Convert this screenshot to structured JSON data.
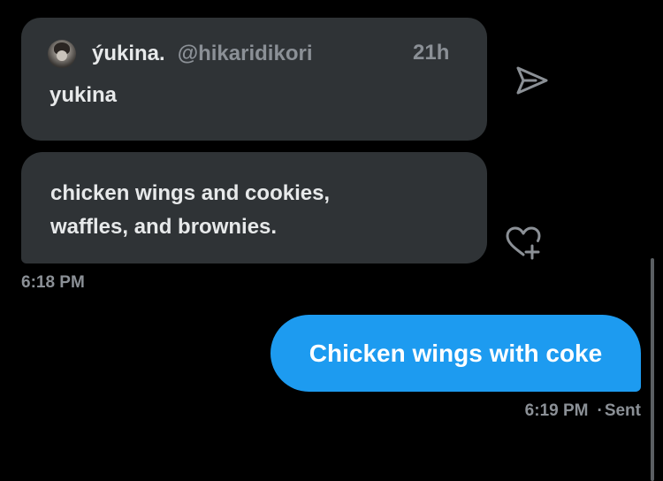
{
  "quoted_post": {
    "display_name": "ýukina.",
    "handle": "@hikaridikori",
    "time": "21h",
    "text": "yukina"
  },
  "received_message": {
    "lines": [
      "chicken wings and cookies,",
      "waffles, and brownies."
    ],
    "time": "6:18 PM"
  },
  "sent_message": {
    "text": "Chicken wings with coke",
    "time": "6:19 PM",
    "status_separator": "·",
    "status": "Sent"
  },
  "icons": {
    "share": "send-icon",
    "react": "heart-plus-icon",
    "avatar": "avatar"
  },
  "colors": {
    "background": "#000000",
    "received_bubble": "#2f3336",
    "sent_bubble": "#1d9bf0",
    "muted_text": "#8b9096",
    "primary_text": "#e7e9ea"
  }
}
